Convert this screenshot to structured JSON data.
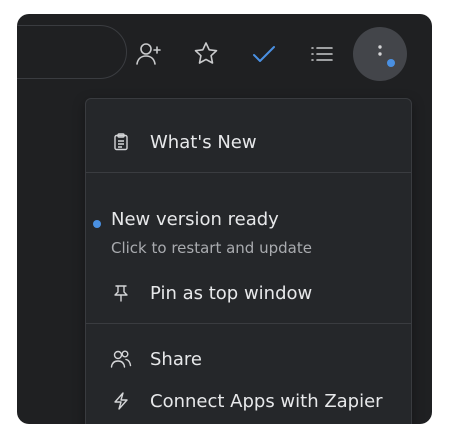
{
  "toolbar": {
    "icons": [
      "add-user-icon",
      "star-icon",
      "check-icon",
      "list-icon",
      "more-vertical-icon"
    ],
    "accent_color": "#4a90e2"
  },
  "menu": {
    "whats_new": "What's New",
    "update_title": "New version ready",
    "update_subtitle": "Click to restart and update",
    "pin": "Pin as top window",
    "share": "Share",
    "zapier": "Connect Apps with Zapier"
  }
}
